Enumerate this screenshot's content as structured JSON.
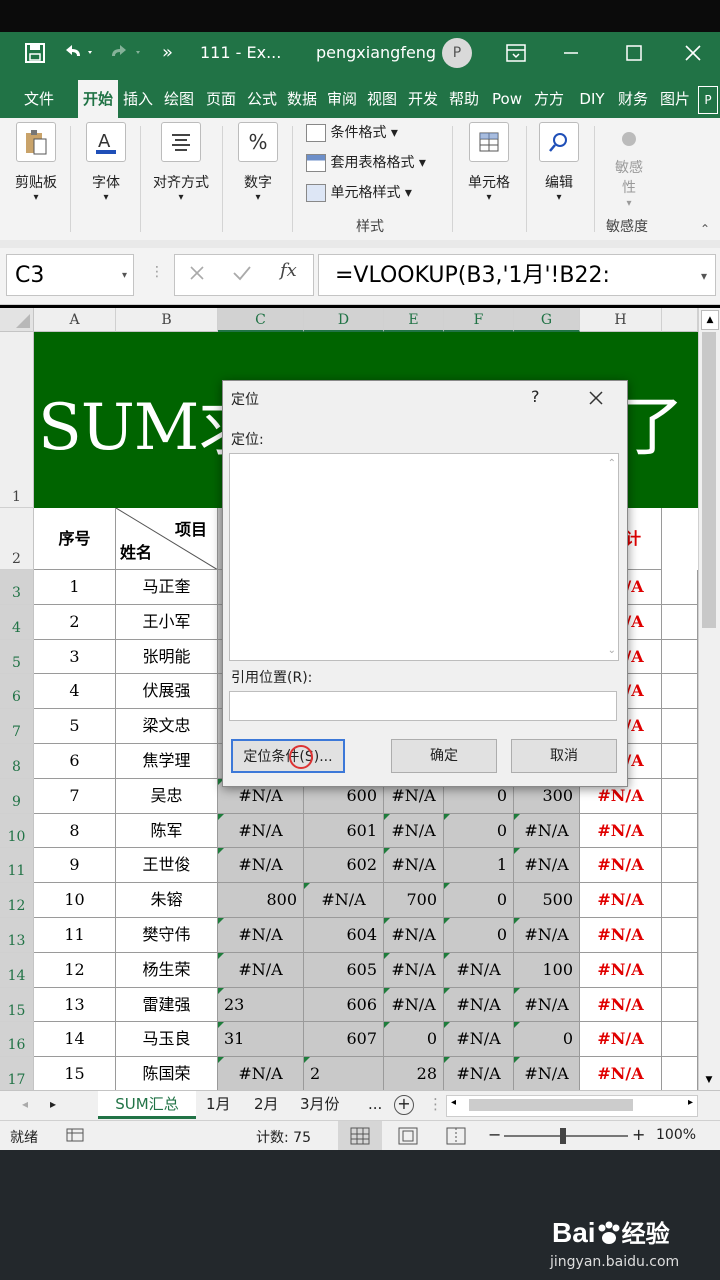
{
  "title_bar": {
    "file_name": "111 - Ex...",
    "user": "pengxiangfeng",
    "avatar": "P",
    "quick_more": "»"
  },
  "ribbon_tabs": [
    "文件",
    "开始",
    "插入",
    "绘图",
    "页面",
    "公式",
    "数据",
    "审阅",
    "视图",
    "开发",
    "帮助",
    "Pow",
    "方方",
    "DIY",
    "财务",
    "图片"
  ],
  "ribbon": {
    "clipboard": "剪贴板",
    "font": "字体",
    "alignment": "对齐方式",
    "number": "数字",
    "cond_format": "条件格式",
    "table_format": "套用表格格式",
    "cell_style": "单元格样式",
    "styles_group": "样式",
    "cells": "单元格",
    "edit": "编辑",
    "sensitivity_btn": "敏感性",
    "sensitivity_group": "敏感度"
  },
  "formula_bar": {
    "name_box": "C3",
    "formula": "=VLOOKUP(B3,'1月'!B22:",
    "fx": "fx"
  },
  "columns": [
    "A",
    "B",
    "C",
    "D",
    "E",
    "F",
    "G",
    "H"
  ],
  "row_numbers": [
    "1",
    "2",
    "3",
    "4",
    "5",
    "6",
    "7",
    "8",
    "9",
    "10",
    "11",
    "12",
    "13",
    "14",
    "15",
    "16",
    "17"
  ],
  "sheet": {
    "banner_text": "SUM求",
    "banner_tail": "了",
    "header_seq": "序号",
    "header_item": "项目",
    "header_name": "姓名",
    "header_total_suffix": "计",
    "rows": [
      {
        "seq": "1",
        "name": "马正奎",
        "c": "",
        "d": "",
        "e": "",
        "f": "",
        "g": "",
        "h": "#N/A"
      },
      {
        "seq": "2",
        "name": "王小军",
        "c": "",
        "d": "",
        "e": "",
        "f": "",
        "g": "",
        "h": "#N/A"
      },
      {
        "seq": "3",
        "name": "张明能",
        "c": "",
        "d": "",
        "e": "",
        "f": "",
        "g": "",
        "h": "#N/A"
      },
      {
        "seq": "4",
        "name": "伏展强",
        "c": "",
        "d": "",
        "e": "",
        "f": "",
        "g": "",
        "h": "#N/A"
      },
      {
        "seq": "5",
        "name": "梁文忠",
        "c": "",
        "d": "",
        "e": "",
        "f": "",
        "g": "",
        "h": "#N/A"
      },
      {
        "seq": "6",
        "name": "焦学理",
        "c": "",
        "d": "",
        "e": "",
        "f": "",
        "g": "",
        "h": "#N/A"
      },
      {
        "seq": "7",
        "name": "吴忠",
        "c": "#N/A",
        "d": "600",
        "e": "#N/A",
        "f": "0",
        "g": "300",
        "h": "#N/A"
      },
      {
        "seq": "8",
        "name": "陈军",
        "c": "#N/A",
        "d": "601",
        "e": "#N/A",
        "f": "0",
        "g": "#N/A",
        "h": "#N/A"
      },
      {
        "seq": "9",
        "name": "王世俊",
        "c": "#N/A",
        "d": "602",
        "e": "#N/A",
        "f": "1",
        "g": "#N/A",
        "h": "#N/A"
      },
      {
        "seq": "10",
        "name": "朱镕",
        "c": "800",
        "d": "#N/A",
        "e": "700",
        "f": "0",
        "g": "500",
        "h": "#N/A"
      },
      {
        "seq": "11",
        "name": "樊守伟",
        "c": "#N/A",
        "d": "604",
        "e": "#N/A",
        "f": "0",
        "g": "#N/A",
        "h": "#N/A"
      },
      {
        "seq": "12",
        "name": "杨生荣",
        "c": "#N/A",
        "d": "605",
        "e": "#N/A",
        "f": "#N/A",
        "g": "100",
        "h": "#N/A"
      },
      {
        "seq": "13",
        "name": "雷建强",
        "c": "23",
        "d": "606",
        "e": "#N/A",
        "f": "#N/A",
        "g": "#N/A",
        "h": "#N/A"
      },
      {
        "seq": "14",
        "name": "马玉良",
        "c": "31",
        "d": "607",
        "e": "0",
        "f": "#N/A",
        "g": "0",
        "h": "#N/A"
      },
      {
        "seq": "15",
        "name": "陈国荣",
        "c": "#N/A",
        "d": "2",
        "e": "28",
        "f": "#N/A",
        "g": "#N/A",
        "h": "#N/A"
      }
    ]
  },
  "dialog": {
    "title": "定位",
    "help": "?",
    "list_label": "定位:",
    "ref_label": "引用位置(R):",
    "special_button": "定位条件(S)...",
    "ok_button": "确定",
    "cancel_button": "取消"
  },
  "sheet_tabs": [
    "SUM汇总",
    "1月",
    "2月",
    "3月份",
    "..."
  ],
  "status": {
    "ready": "就绪",
    "count": "计数: 75",
    "zoom": "100%"
  },
  "watermark": {
    "brand": "Bai",
    "brand2": "经验",
    "url": "jingyan.baidu.com"
  }
}
